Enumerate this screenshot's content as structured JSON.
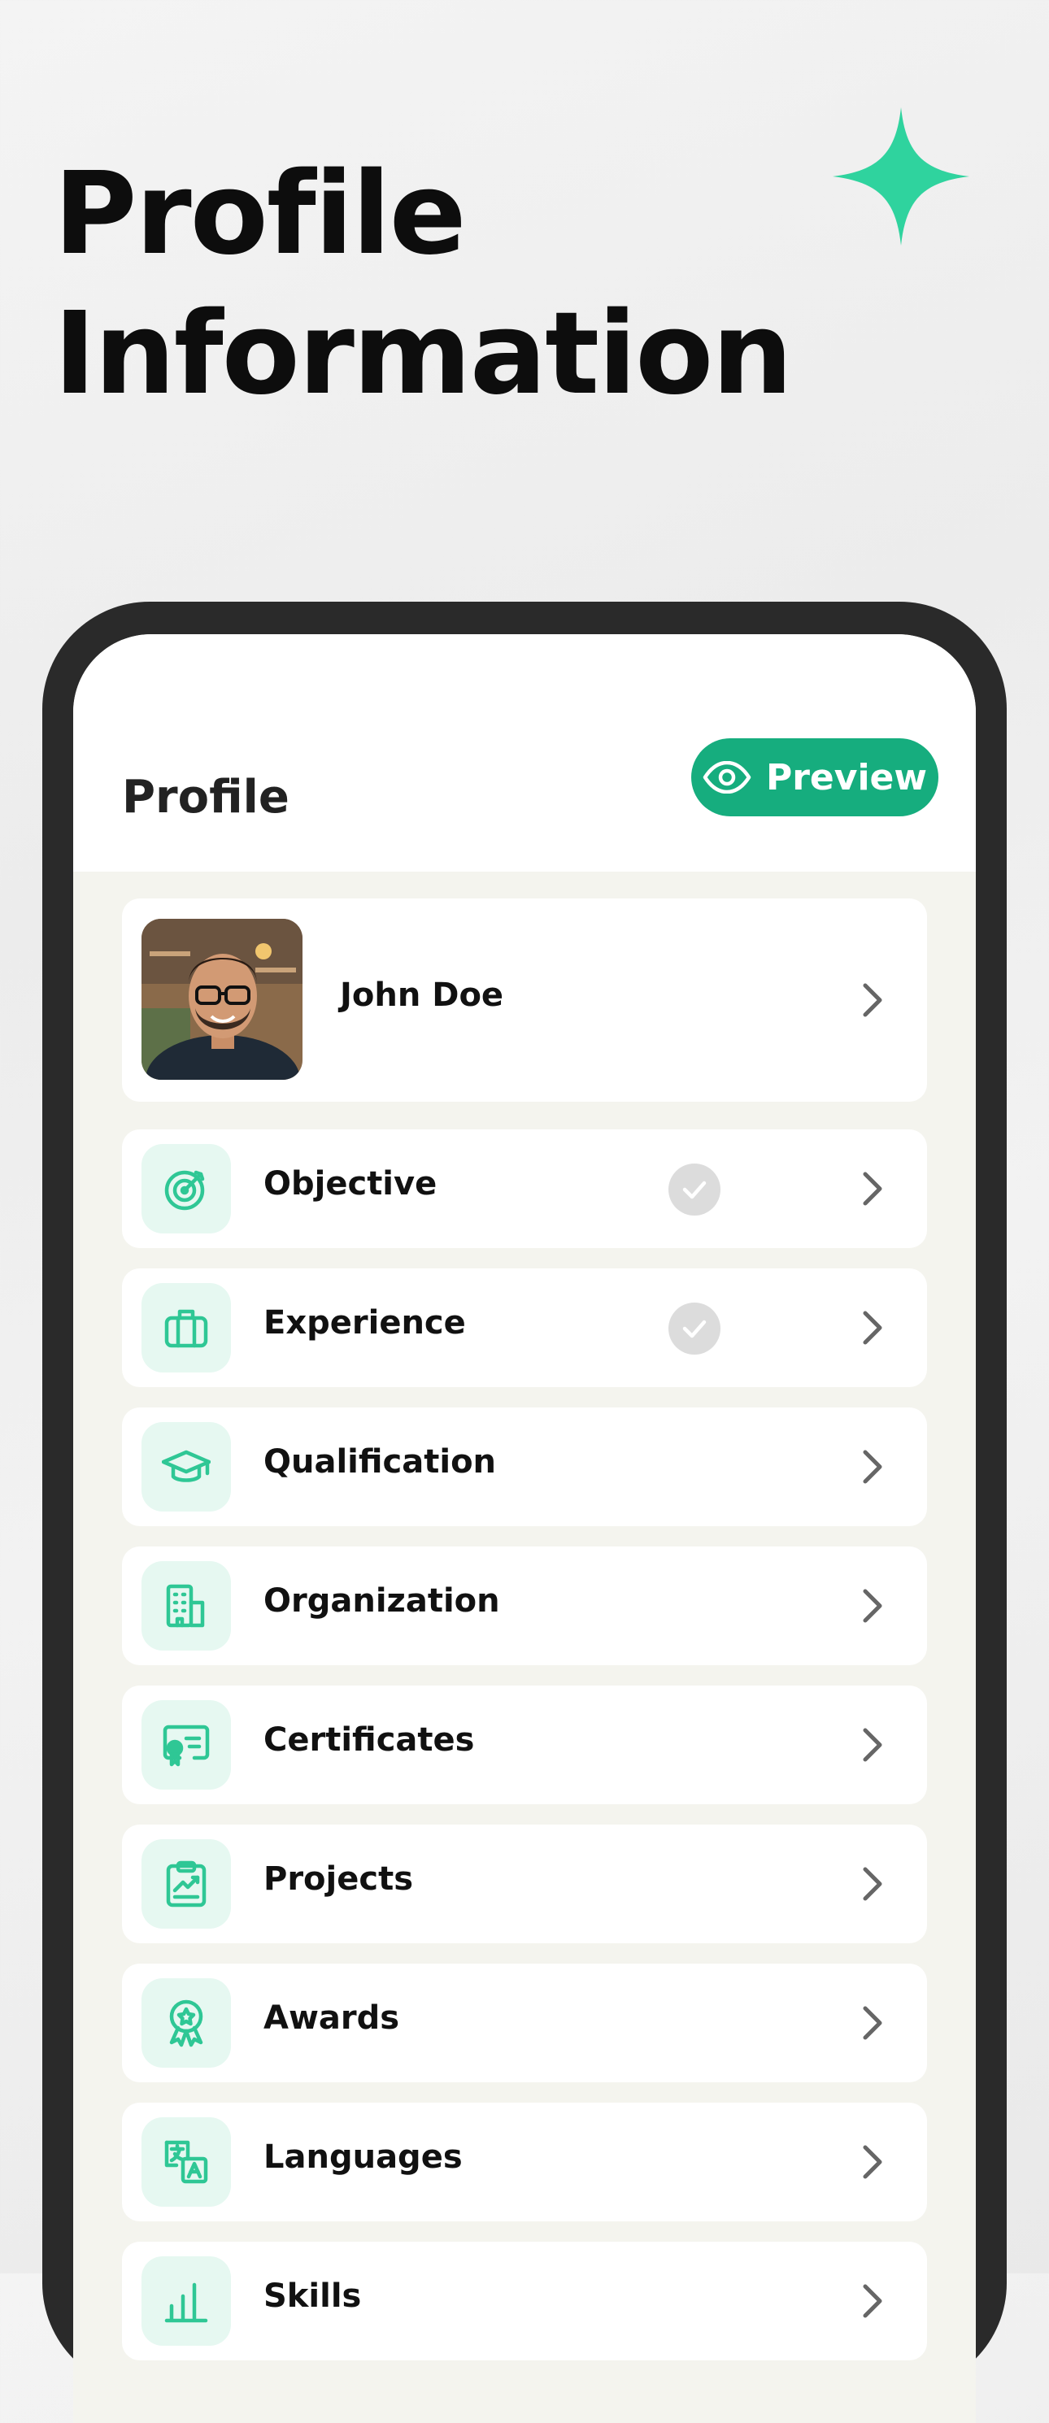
{
  "hero": {
    "line1": "Profile",
    "line2": "Information",
    "accent_color": "#2fd39e"
  },
  "app": {
    "title": "Profile",
    "preview_label": "Preview",
    "brand_color": "#16ad7e"
  },
  "profile": {
    "name": "John Doe"
  },
  "sections": [
    {
      "label": "Objective",
      "icon": "target-icon",
      "completed": true
    },
    {
      "label": "Experience",
      "icon": "briefcase-icon",
      "completed": true
    },
    {
      "label": "Qualification",
      "icon": "graduation-cap-icon",
      "completed": false
    },
    {
      "label": "Organization",
      "icon": "building-icon",
      "completed": false
    },
    {
      "label": "Certificates",
      "icon": "certificate-icon",
      "completed": false
    },
    {
      "label": "Projects",
      "icon": "clipboard-chart-icon",
      "completed": false
    },
    {
      "label": "Awards",
      "icon": "award-badge-icon",
      "completed": false
    },
    {
      "label": "Languages",
      "icon": "translate-icon",
      "completed": false
    },
    {
      "label": "Skills",
      "icon": "bar-chart-icon",
      "completed": false
    }
  ]
}
